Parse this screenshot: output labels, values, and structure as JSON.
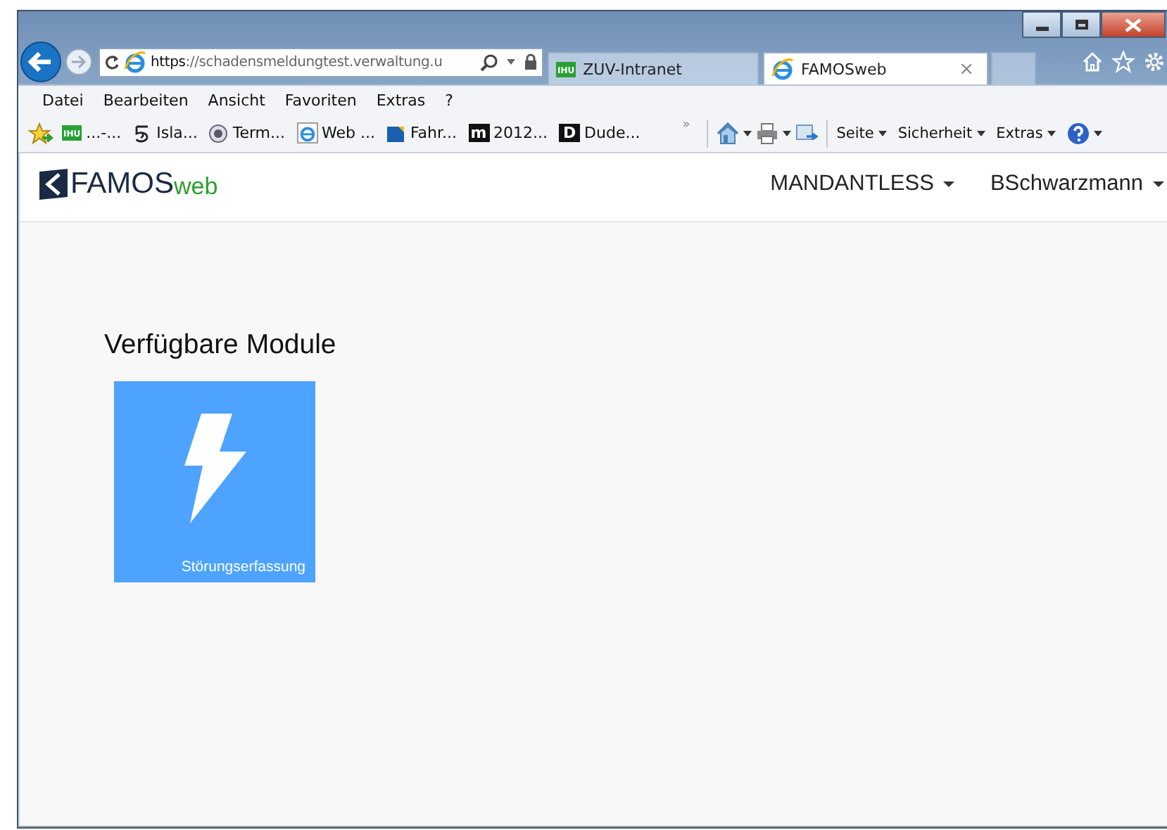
{
  "browser": {
    "address": "https://schadensmeldungtest.verwaltung.u",
    "tabs": [
      {
        "label": "ZUV-Intranet",
        "badge": "IHU",
        "selected": false
      },
      {
        "label": "FAMOSweb",
        "selected": true,
        "close": "×"
      }
    ],
    "menu": [
      "Datei",
      "Bearbeiten",
      "Ansicht",
      "Favoriten",
      "Extras",
      "?"
    ],
    "favorites": [
      {
        "label": "...-...",
        "badge": "IHU"
      },
      {
        "label": "Isla..."
      },
      {
        "label": "Term..."
      },
      {
        "label": "Web ..."
      },
      {
        "label": "Fahr..."
      },
      {
        "label": "2012...",
        "badge": "m"
      },
      {
        "label": "Dude...",
        "badge": "D"
      }
    ],
    "more": "»",
    "commands": [
      "Seite",
      "Sicherheit",
      "Extras"
    ]
  },
  "app": {
    "logo": {
      "main": "FAMOS",
      "suffix": "web"
    },
    "nav": [
      "MANDANTLESS",
      "BSchwarzmann"
    ],
    "heading": "Verfügbare Module",
    "modules": [
      {
        "label": "Störungserfassung"
      }
    ]
  }
}
